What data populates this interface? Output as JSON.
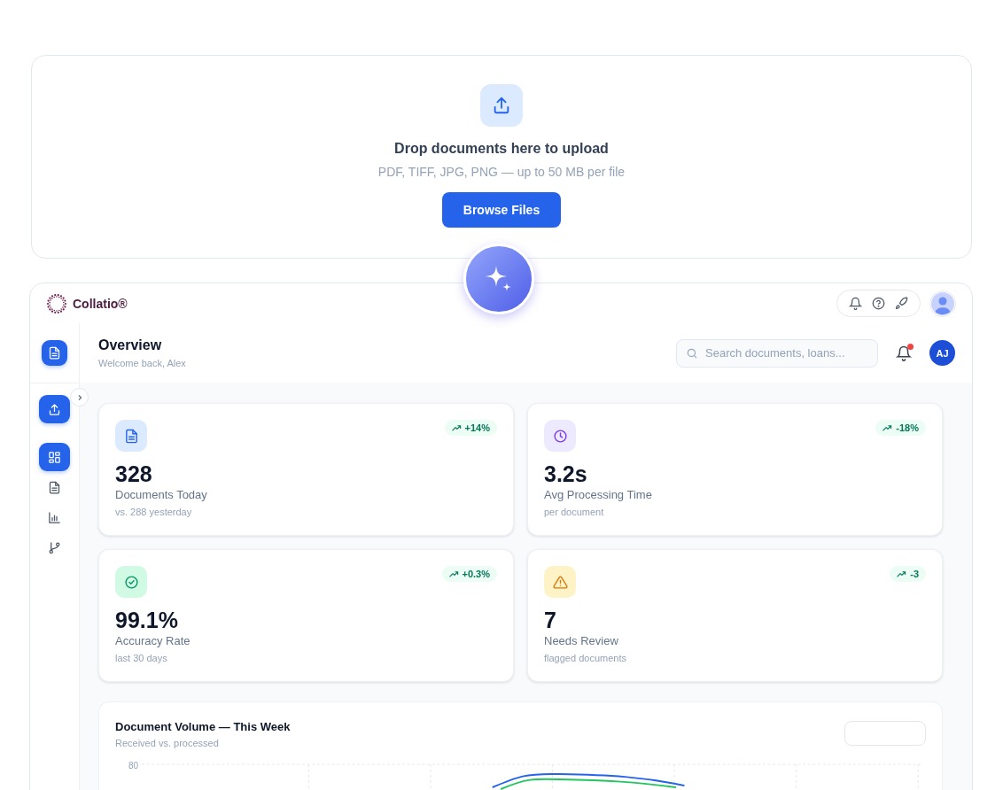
{
  "upload": {
    "title": "Drop documents here to upload",
    "subtitle": "PDF, TIFF, JPG, PNG — up to 50 MB per file",
    "button": "Browse Files"
  },
  "app": {
    "brand": "Collatio®"
  },
  "sidebar": {
    "items": [
      {
        "kind": "dashboard",
        "selected": true
      },
      {
        "kind": "document",
        "selected": false
      },
      {
        "kind": "chart",
        "selected": false
      },
      {
        "kind": "branch",
        "selected": false
      }
    ]
  },
  "header": {
    "title": "Overview",
    "subtitle": "Welcome back, Alex",
    "search": {
      "placeholder": "Search documents, loans..."
    },
    "notifications": {
      "unread": true
    },
    "avatar": "AJ"
  },
  "stats": [
    {
      "kind": "document",
      "value": "328",
      "label": "Documents Today",
      "note": "vs. 288 yesterday",
      "trend": "+14%"
    },
    {
      "kind": "clock",
      "value": "3.2s",
      "label": "Avg Processing Time",
      "note": "per document",
      "trend": "-18%"
    },
    {
      "kind": "check",
      "value": "99.1%",
      "label": "Accuracy Rate",
      "note": "last 30 days",
      "trend": "+0.3%"
    },
    {
      "kind": "warning",
      "value": "7",
      "label": "Needs Review",
      "note": "flagged documents",
      "trend": "-3"
    }
  ],
  "volume_chart": {
    "title": "Document Volume — This Week",
    "subtitle": "Received vs. processed",
    "y_tick": "80"
  }
}
